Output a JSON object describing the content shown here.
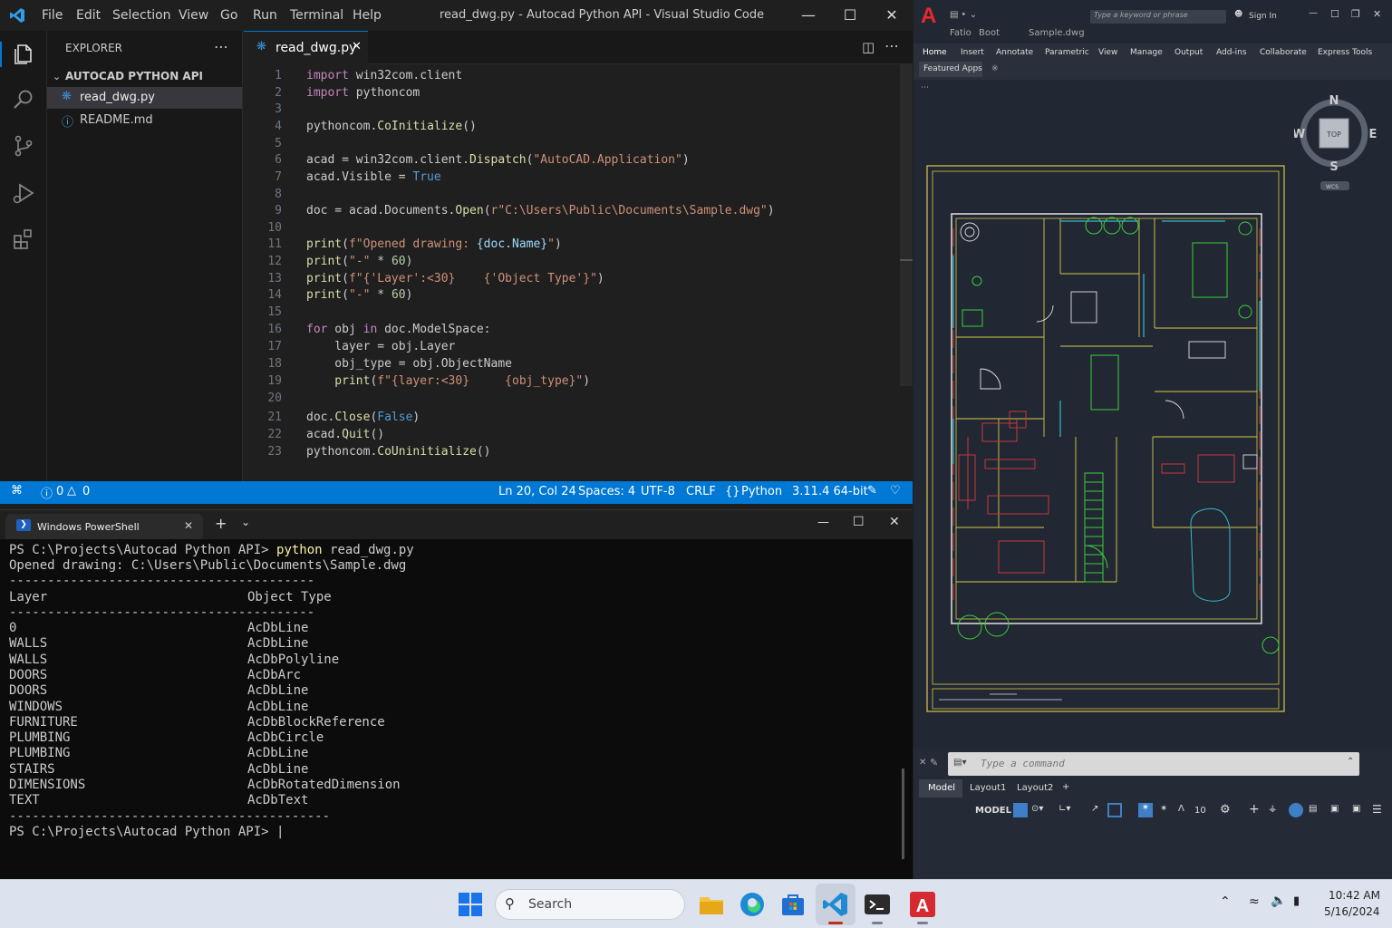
{
  "vscode": {
    "menu": [
      "File",
      "Edit",
      "Selection",
      "View",
      "Go",
      "Run",
      "Terminal",
      "Help"
    ],
    "window_title": "read_dwg.py - Autocad Python API - Visual Studio Code",
    "explorer_title": "EXPLORER",
    "project_folder": "AUTOCAD PYTHON API",
    "files": [
      "read_dwg.py",
      "README.md"
    ],
    "active_tab": "read_dwg.py",
    "line_numbers": [
      "1",
      "2",
      "3",
      "4",
      "5",
      "6",
      "7",
      "8",
      "9",
      "10",
      "11",
      "12",
      "13",
      "14",
      "15",
      "16",
      "17",
      "18",
      "19",
      "20",
      "21",
      "22",
      "23"
    ],
    "status": {
      "problems": "0",
      "warnings": "0",
      "position": "Ln 20, Col 24",
      "spaces": "Spaces: 4",
      "encoding": "UTF-8",
      "eol": "CRLF",
      "language": "Python",
      "interpreter": "3.11.4 64-bit"
    }
  },
  "code": {
    "l1a": "import",
    "l1b": " win32com.client",
    "l2a": "import",
    "l2b": " pythoncom",
    "l4a": "pythoncom.",
    "l4b": "CoInitialize",
    "l4c": "()",
    "l6a": "acad = win32com.client.",
    "l6b": "Dispatch",
    "l6c": "(",
    "l6d": "\"AutoCAD.Application\"",
    "l6e": ")",
    "l7a": "acad.Visible = ",
    "l7b": "True",
    "l9a": "doc = acad.Documents.",
    "l9b": "Open",
    "l9c": "(",
    "l9d": "r\"C:\\Users\\Public\\Documents\\Sample.dwg\"",
    "l9e": ")",
    "l11a": "print",
    "l11b": "(",
    "l11c": "f\"Opened drawing: ",
    "l11d": "{doc.Name}",
    "l11e": "\"",
    "l11f": ")",
    "l12a": "print",
    "l12b": "(",
    "l12c": "\"-\"",
    "l12d": " * ",
    "l12e": "60",
    "l12f": ")",
    "l13a": "print",
    "l13b": "(",
    "l13c": "f\"{'Layer':<30}    {'Object Type'}\"",
    "l13d": ")",
    "l14a": "print",
    "l14b": "(",
    "l14c": "\"-\"",
    "l14d": " * ",
    "l14e": "60",
    "l14f": ")",
    "l16a": "for",
    "l16b": " obj ",
    "l16c": "in",
    "l16d": " doc.ModelSpace:",
    "l17": "    layer = obj.Layer",
    "l18": "    obj_type = obj.ObjectName",
    "l19a": "    print",
    "l19b": "(",
    "l19c": "f\"{layer:<30}     {obj_type}\"",
    "l19d": ")",
    "l21a": "doc.",
    "l21b": "Close",
    "l21c": "(",
    "l21d": "False",
    "l21e": ")",
    "l22a": "acad.",
    "l22b": "Quit",
    "l22c": "()",
    "l23a": "pythoncom.",
    "l23b": "CoUninitialize",
    "l23c": "()"
  },
  "terminal": {
    "tab_title": "Windows PowerShell",
    "prompt_cmd_prefix": "PS C:\\Projects\\Autocad Python API> ",
    "cmd_python": "python",
    "cmd_args": " read_dwg.py",
    "opened": "Opened drawing: C:\\Users\\Public\\Documents\\Sample.dwg",
    "rule": "----------------------------------------",
    "rule_long": "------------------------------------------",
    "header_layer": "Layer",
    "header_type": "Object Type",
    "rows": [
      {
        "layer": "0",
        "type": "AcDbLine"
      },
      {
        "layer": "WALLS",
        "type": "AcDbLine"
      },
      {
        "layer": "WALLS",
        "type": "AcDbPolyline"
      },
      {
        "layer": "DOORS",
        "type": "AcDbArc"
      },
      {
        "layer": "DOORS",
        "type": "AcDbLine"
      },
      {
        "layer": "WINDOWS",
        "type": "AcDbLine"
      },
      {
        "layer": "FURNITURE",
        "type": "AcDbBlockReference"
      },
      {
        "layer": "PLUMBING",
        "type": "AcDbCircle"
      },
      {
        "layer": "PLUMBING",
        "type": "AcDbLine"
      },
      {
        "layer": "STAIRS",
        "type": "AcDbLine"
      },
      {
        "layer": "DIMENSIONS",
        "type": "AcDbRotatedDimension"
      },
      {
        "layer": "TEXT",
        "type": "AcDbText"
      }
    ],
    "final_prompt": "PS C:\\Projects\\Autocad Python API> "
  },
  "autocad": {
    "search_placeholder": "Type a keyword or phrase",
    "sign_in": "Sign In",
    "quick_a": "Fatio",
    "quick_b": "Boot",
    "doc_title": "Sample.dwg",
    "ribbon_tabs": [
      "Home",
      "Insert",
      "Annotate",
      "Parametric",
      "View",
      "Manage",
      "Output",
      "Add-ins",
      "Collaborate",
      "Express Tools"
    ],
    "featured": "Featured Apps",
    "compass": {
      "n": "N",
      "s": "S",
      "e": "E",
      "w": "W",
      "top": "TOP",
      "wcs": "WCS"
    },
    "cmd_placeholder": "Type a command",
    "layout_tabs": [
      "Model",
      "Layout1",
      "Layout2"
    ],
    "status_model": "MODEL",
    "status_scale": "10",
    "colors": {
      "wall": "#e0e0e0",
      "yellow": "#d6c848",
      "red": "#c83a3a",
      "green": "#3ccf3c",
      "cyan": "#3ab8c8"
    }
  },
  "taskbar": {
    "search": "Search",
    "time": "10:42 AM",
    "date": "5/16/2024"
  }
}
